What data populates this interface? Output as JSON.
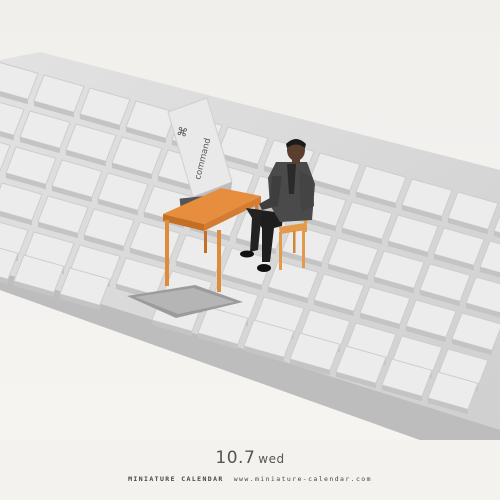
{
  "photo": {
    "subject": "miniature-figure-at-desk-on-keyboard",
    "colors": {
      "background": "#f4f2ef",
      "keyboard_body": "#d9d9d9",
      "key": "#ededed",
      "desk": "#e08a3c",
      "chair": "#e39a4a",
      "figure_jacket": "#4a4a4a",
      "figure_pants": "#1e1e1e"
    },
    "command_key_symbol": "⌘",
    "command_key_label": "command"
  },
  "caption": {
    "day": "10.7",
    "weekday": "wed",
    "brand": "MINIATURE CALENDAR",
    "url": "www.miniature-calendar.com"
  }
}
